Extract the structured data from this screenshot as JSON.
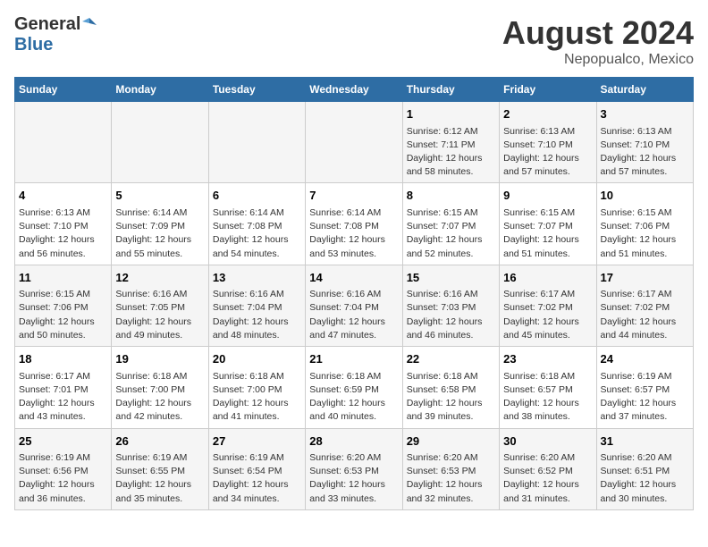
{
  "logo": {
    "general": "General",
    "blue": "Blue"
  },
  "title": "August 2024",
  "subtitle": "Nepopualco, Mexico",
  "days_of_week": [
    "Sunday",
    "Monday",
    "Tuesday",
    "Wednesday",
    "Thursday",
    "Friday",
    "Saturday"
  ],
  "weeks": [
    [
      {
        "day": "",
        "info": ""
      },
      {
        "day": "",
        "info": ""
      },
      {
        "day": "",
        "info": ""
      },
      {
        "day": "",
        "info": ""
      },
      {
        "day": "1",
        "info": "Sunrise: 6:12 AM\nSunset: 7:11 PM\nDaylight: 12 hours\nand 58 minutes."
      },
      {
        "day": "2",
        "info": "Sunrise: 6:13 AM\nSunset: 7:10 PM\nDaylight: 12 hours\nand 57 minutes."
      },
      {
        "day": "3",
        "info": "Sunrise: 6:13 AM\nSunset: 7:10 PM\nDaylight: 12 hours\nand 57 minutes."
      }
    ],
    [
      {
        "day": "4",
        "info": "Sunrise: 6:13 AM\nSunset: 7:10 PM\nDaylight: 12 hours\nand 56 minutes."
      },
      {
        "day": "5",
        "info": "Sunrise: 6:14 AM\nSunset: 7:09 PM\nDaylight: 12 hours\nand 55 minutes."
      },
      {
        "day": "6",
        "info": "Sunrise: 6:14 AM\nSunset: 7:08 PM\nDaylight: 12 hours\nand 54 minutes."
      },
      {
        "day": "7",
        "info": "Sunrise: 6:14 AM\nSunset: 7:08 PM\nDaylight: 12 hours\nand 53 minutes."
      },
      {
        "day": "8",
        "info": "Sunrise: 6:15 AM\nSunset: 7:07 PM\nDaylight: 12 hours\nand 52 minutes."
      },
      {
        "day": "9",
        "info": "Sunrise: 6:15 AM\nSunset: 7:07 PM\nDaylight: 12 hours\nand 51 minutes."
      },
      {
        "day": "10",
        "info": "Sunrise: 6:15 AM\nSunset: 7:06 PM\nDaylight: 12 hours\nand 51 minutes."
      }
    ],
    [
      {
        "day": "11",
        "info": "Sunrise: 6:15 AM\nSunset: 7:06 PM\nDaylight: 12 hours\nand 50 minutes."
      },
      {
        "day": "12",
        "info": "Sunrise: 6:16 AM\nSunset: 7:05 PM\nDaylight: 12 hours\nand 49 minutes."
      },
      {
        "day": "13",
        "info": "Sunrise: 6:16 AM\nSunset: 7:04 PM\nDaylight: 12 hours\nand 48 minutes."
      },
      {
        "day": "14",
        "info": "Sunrise: 6:16 AM\nSunset: 7:04 PM\nDaylight: 12 hours\nand 47 minutes."
      },
      {
        "day": "15",
        "info": "Sunrise: 6:16 AM\nSunset: 7:03 PM\nDaylight: 12 hours\nand 46 minutes."
      },
      {
        "day": "16",
        "info": "Sunrise: 6:17 AM\nSunset: 7:02 PM\nDaylight: 12 hours\nand 45 minutes."
      },
      {
        "day": "17",
        "info": "Sunrise: 6:17 AM\nSunset: 7:02 PM\nDaylight: 12 hours\nand 44 minutes."
      }
    ],
    [
      {
        "day": "18",
        "info": "Sunrise: 6:17 AM\nSunset: 7:01 PM\nDaylight: 12 hours\nand 43 minutes."
      },
      {
        "day": "19",
        "info": "Sunrise: 6:18 AM\nSunset: 7:00 PM\nDaylight: 12 hours\nand 42 minutes."
      },
      {
        "day": "20",
        "info": "Sunrise: 6:18 AM\nSunset: 7:00 PM\nDaylight: 12 hours\nand 41 minutes."
      },
      {
        "day": "21",
        "info": "Sunrise: 6:18 AM\nSunset: 6:59 PM\nDaylight: 12 hours\nand 40 minutes."
      },
      {
        "day": "22",
        "info": "Sunrise: 6:18 AM\nSunset: 6:58 PM\nDaylight: 12 hours\nand 39 minutes."
      },
      {
        "day": "23",
        "info": "Sunrise: 6:18 AM\nSunset: 6:57 PM\nDaylight: 12 hours\nand 38 minutes."
      },
      {
        "day": "24",
        "info": "Sunrise: 6:19 AM\nSunset: 6:57 PM\nDaylight: 12 hours\nand 37 minutes."
      }
    ],
    [
      {
        "day": "25",
        "info": "Sunrise: 6:19 AM\nSunset: 6:56 PM\nDaylight: 12 hours\nand 36 minutes."
      },
      {
        "day": "26",
        "info": "Sunrise: 6:19 AM\nSunset: 6:55 PM\nDaylight: 12 hours\nand 35 minutes."
      },
      {
        "day": "27",
        "info": "Sunrise: 6:19 AM\nSunset: 6:54 PM\nDaylight: 12 hours\nand 34 minutes."
      },
      {
        "day": "28",
        "info": "Sunrise: 6:20 AM\nSunset: 6:53 PM\nDaylight: 12 hours\nand 33 minutes."
      },
      {
        "day": "29",
        "info": "Sunrise: 6:20 AM\nSunset: 6:53 PM\nDaylight: 12 hours\nand 32 minutes."
      },
      {
        "day": "30",
        "info": "Sunrise: 6:20 AM\nSunset: 6:52 PM\nDaylight: 12 hours\nand 31 minutes."
      },
      {
        "day": "31",
        "info": "Sunrise: 6:20 AM\nSunset: 6:51 PM\nDaylight: 12 hours\nand 30 minutes."
      }
    ]
  ]
}
